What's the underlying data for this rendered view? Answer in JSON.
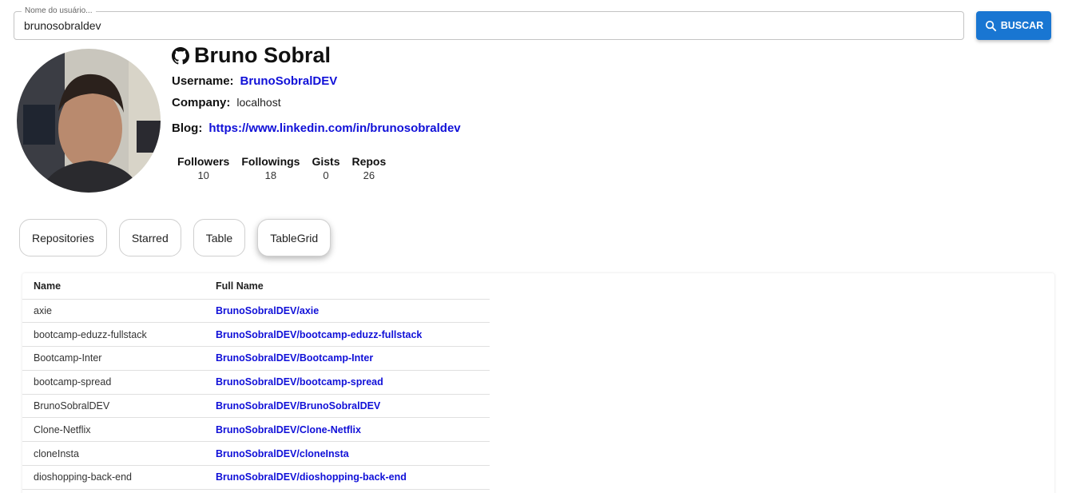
{
  "search": {
    "legend": "Nome do usuário...",
    "value": "brunosobraldev",
    "button_label": "BUSCAR"
  },
  "profile": {
    "name": "Bruno Sobral",
    "username_label": "Username:",
    "username": "BrunoSobralDEV",
    "company_label": "Company:",
    "company": "localhost",
    "blog_label": "Blog:",
    "blog": "https://www.linkedin.com/in/brunosobraldev",
    "stats": [
      {
        "label": "Followers",
        "value": "10"
      },
      {
        "label": "Followings",
        "value": "18"
      },
      {
        "label": "Gists",
        "value": "0"
      },
      {
        "label": "Repos",
        "value": "26"
      }
    ]
  },
  "tabs": [
    {
      "label": "Repositories"
    },
    {
      "label": "Starred"
    },
    {
      "label": "Table"
    },
    {
      "label": "TableGrid"
    }
  ],
  "table": {
    "headers": [
      "Name",
      "Full Name"
    ],
    "rows": [
      {
        "name": "axie",
        "full_name": "BrunoSobralDEV/axie"
      },
      {
        "name": "bootcamp-eduzz-fullstack",
        "full_name": "BrunoSobralDEV/bootcamp-eduzz-fullstack"
      },
      {
        "name": "Bootcamp-Inter",
        "full_name": "BrunoSobralDEV/Bootcamp-Inter"
      },
      {
        "name": "bootcamp-spread",
        "full_name": "BrunoSobralDEV/bootcamp-spread"
      },
      {
        "name": "BrunoSobralDEV",
        "full_name": "BrunoSobralDEV/BrunoSobralDEV"
      },
      {
        "name": "Clone-Netflix",
        "full_name": "BrunoSobralDEV/Clone-Netflix"
      },
      {
        "name": "cloneInsta",
        "full_name": "BrunoSobralDEV/cloneInsta"
      },
      {
        "name": "dioshopping-back-end",
        "full_name": "BrunoSobralDEV/dioshopping-back-end"
      }
    ]
  },
  "colors": {
    "accent": "#1976d2",
    "link": "#1010d8"
  },
  "icons": {
    "search_button": "search-icon",
    "profile": "github-icon"
  }
}
